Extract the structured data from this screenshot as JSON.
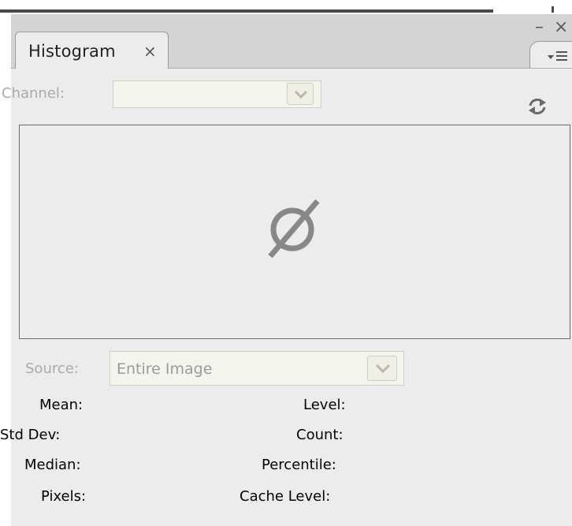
{
  "panel": {
    "tab_title": "Histogram",
    "tab_close_symbol": "×",
    "minimize_symbol": "–",
    "close_symbol": "×",
    "menu_icon": "panel-menu-icon"
  },
  "channel": {
    "label": "Channel:",
    "value": ""
  },
  "refresh_icon": "refresh-icon",
  "histogram": {
    "empty_icon": "empty-set-icon",
    "empty_color": "#888888"
  },
  "source": {
    "label": "Source:",
    "value": "Entire Image"
  },
  "stats_left": {
    "mean": "Mean:",
    "std_dev": "Std Dev:",
    "median": "Median:",
    "pixels": "Pixels:"
  },
  "stats_right": {
    "level": "Level:",
    "count": "Count:",
    "percentile": "Percentile:",
    "cache_level": "Cache Level:"
  }
}
